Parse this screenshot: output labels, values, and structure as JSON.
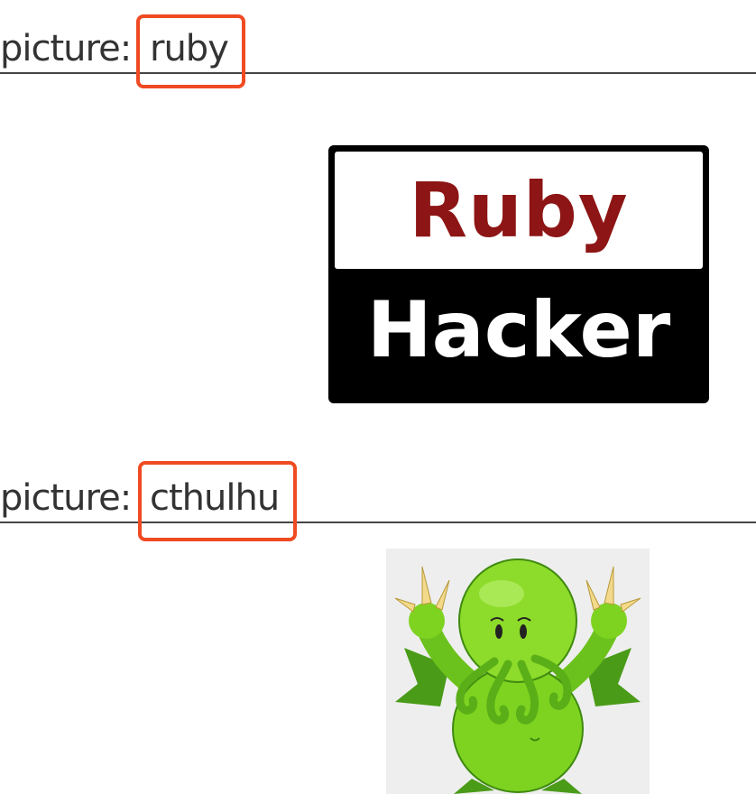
{
  "sections": [
    {
      "prefix": "picture:",
      "name": "ruby",
      "badge": {
        "top_text": "Ruby",
        "bottom_text": "Hacker",
        "top_color": "#8d1515",
        "frame_color": "#000000"
      }
    },
    {
      "prefix": "picture:",
      "name": "cthulhu",
      "image_subject": "green-cthulhu-cartoon",
      "body_color": "#7ed321",
      "claw_color": "#f3d98a"
    }
  ],
  "colors": {
    "highlight": "#f04a22",
    "text": "#333333",
    "rule": "#444444"
  }
}
